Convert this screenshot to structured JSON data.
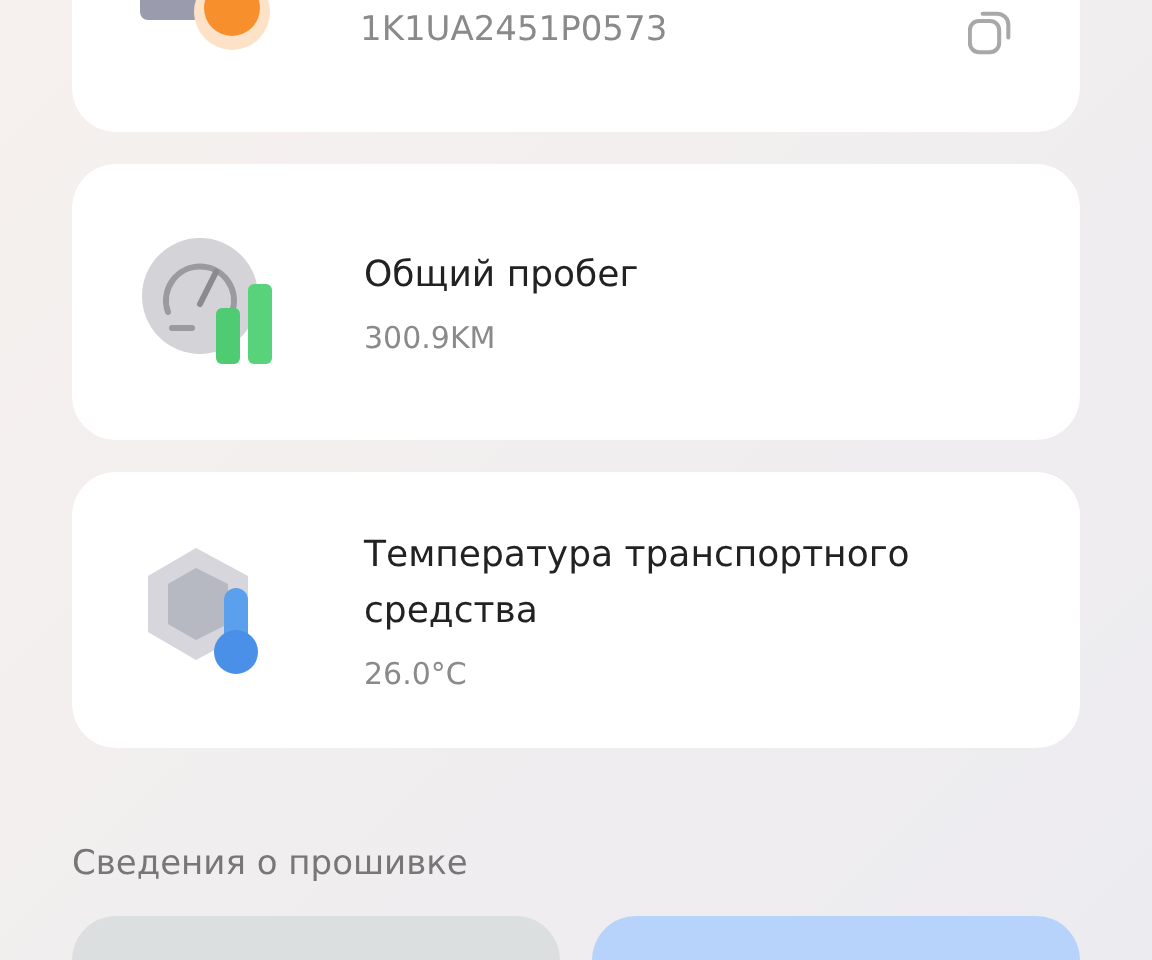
{
  "vin_card": {
    "value": "1K1UA2451P0573"
  },
  "cards": [
    {
      "kind": "mileage",
      "title": "Общий пробег",
      "value": "300.9KM"
    },
    {
      "kind": "temperature",
      "title": "Температура транспортного средства",
      "value": "26.0°C"
    }
  ],
  "firmware_section": {
    "title": "Сведения о прошивке"
  }
}
